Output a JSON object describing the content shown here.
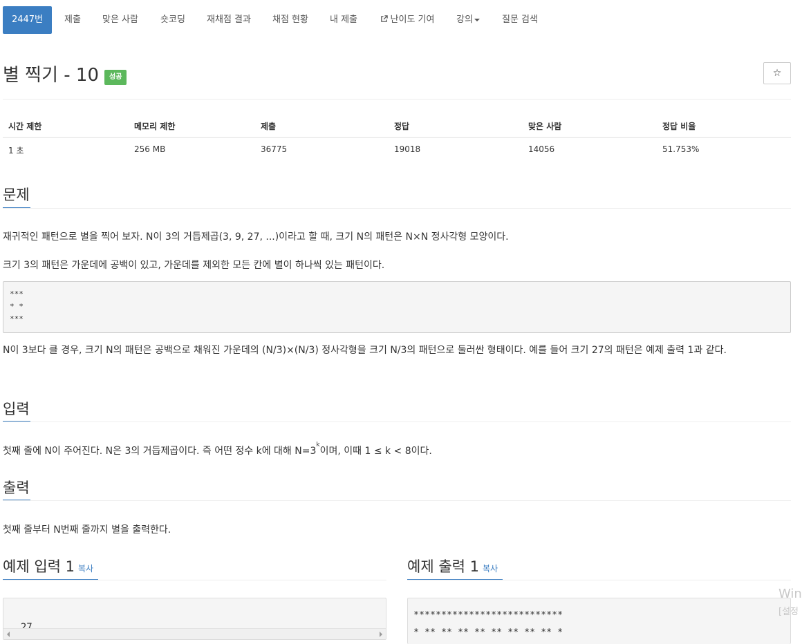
{
  "nav": {
    "items": [
      {
        "label": "2447번"
      },
      {
        "label": "제출"
      },
      {
        "label": "맞은 사람"
      },
      {
        "label": "숏코딩"
      },
      {
        "label": "재채점 결과"
      },
      {
        "label": "채점 현황"
      },
      {
        "label": "내 제출"
      },
      {
        "label": "난이도 기여"
      },
      {
        "label": "강의"
      },
      {
        "label": "질문 검색"
      }
    ],
    "active_color": "#3b7ec2"
  },
  "problem": {
    "title": "별 찍기 - 10",
    "badge": "성공",
    "badge_color": "#5cb85c",
    "star_glyph": "☆"
  },
  "stats": {
    "headers": [
      "시간 제한",
      "메모리 제한",
      "제출",
      "정답",
      "맞은 사람",
      "정답 비율"
    ],
    "values": [
      "1 초",
      "256 MB",
      "36775",
      "19018",
      "14056",
      "51.753%"
    ]
  },
  "sections": {
    "problem": {
      "heading": "문제",
      "p1": "재귀적인 패턴으로 별을 찍어 보자. N이 3의 거듭제곱(3, 9, 27, ...)이라고 할 때, 크기 N의 패턴은 N×N 정사각형 모양이다.",
      "p2": "크기 3의 패턴은 가운데에 공백이 있고, 가운데를 제외한 모든 칸에 별이 하나씩 있는 패턴이다.",
      "pattern": "***\n* *\n***",
      "p3": "N이 3보다 클 경우, 크기 N의 패턴은 공백으로 채워진 가운데의 (N/3)×(N/3) 정사각형을 크기 N/3의 패턴으로 둘러싼 형태이다. 예를 들어 크기 27의 패턴은 예제 출력 1과 같다."
    },
    "input": {
      "heading": "입력",
      "p_before": "첫째 줄에 N이 주어진다. N은 3의 거듭제곱이다. 즉 어떤 정수 k에 대해 N=3",
      "p_sup": "k",
      "p_after": "이며, 이때 1 ≤ k < 8이다."
    },
    "output": {
      "heading": "출력",
      "p1": "첫째 줄부터 N번째 줄까지 별을 출력한다."
    }
  },
  "examples": {
    "input_heading": "예제 입력 1",
    "output_heading": "예제 출력 1",
    "copy_label": "복사",
    "input_value": "27",
    "output_value": "***************************\n* ** ** ** ** ** ** ** ** *"
  },
  "watermark": {
    "line1": "Win",
    "line2": "[설정"
  }
}
